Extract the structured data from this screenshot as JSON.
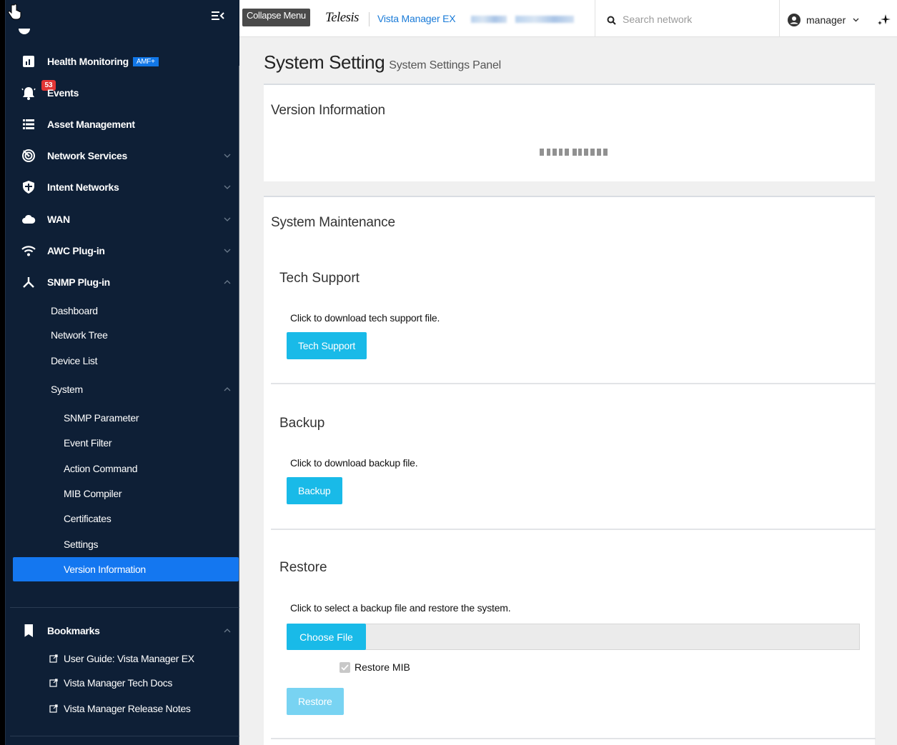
{
  "sidebar": {
    "nav": [
      {
        "label": "Health Monitoring",
        "badge": "AMF+",
        "icon": "bar-chart-icon"
      },
      {
        "label": "Events",
        "count": "53",
        "icon": "bell-icon"
      },
      {
        "label": "Asset Management",
        "icon": "list-icon"
      },
      {
        "label": "Network Services",
        "icon": "radar-icon"
      },
      {
        "label": "Intent Networks",
        "icon": "shield-icon"
      },
      {
        "label": "WAN",
        "icon": "cloud-icon"
      },
      {
        "label": "AWC Plug-in",
        "icon": "wifi-icon"
      },
      {
        "label": "SNMP Plug-in",
        "icon": "network-icon"
      }
    ],
    "snmp_items": [
      "Dashboard",
      "Network Tree",
      "Device List",
      "System"
    ],
    "system_items": [
      "SNMP Parameter",
      "Event Filter",
      "Action Command",
      "MIB Compiler",
      "Certificates",
      "Settings",
      "Version Information"
    ],
    "bookmarks": {
      "label": "Bookmarks",
      "links": [
        "User Guide: Vista Manager EX",
        "Vista Manager Tech Docs",
        "Vista Manager Release Notes"
      ]
    }
  },
  "header": {
    "collapse_label": "Collapse Menu",
    "brand": "Telesis",
    "product": "Vista Manager EX",
    "search_placeholder": "Search network",
    "user": "manager"
  },
  "main": {
    "title": "System Setting",
    "subtitle": "System Settings Panel",
    "version_panel": {
      "title": "Version Information"
    },
    "maintenance": {
      "title": "System Maintenance",
      "tech_support": {
        "title": "Tech Support",
        "text": "Click to download tech support file.",
        "button": "Tech Support"
      },
      "backup": {
        "title": "Backup",
        "text": "Click to download backup file.",
        "button": "Backup"
      },
      "restore": {
        "title": "Restore",
        "text": "Click to select a backup file and restore the system.",
        "choose_file": "Choose File",
        "checkbox_label": "Restore MIB",
        "checkbox_checked": true,
        "button": "Restore"
      }
    }
  },
  "colors": {
    "sidebar_bg": "#0e1f36",
    "active_item": "#1477f0",
    "accent_button": "#19bae8",
    "badge_red": "#e23535",
    "amf_badge": "#1177e8"
  }
}
